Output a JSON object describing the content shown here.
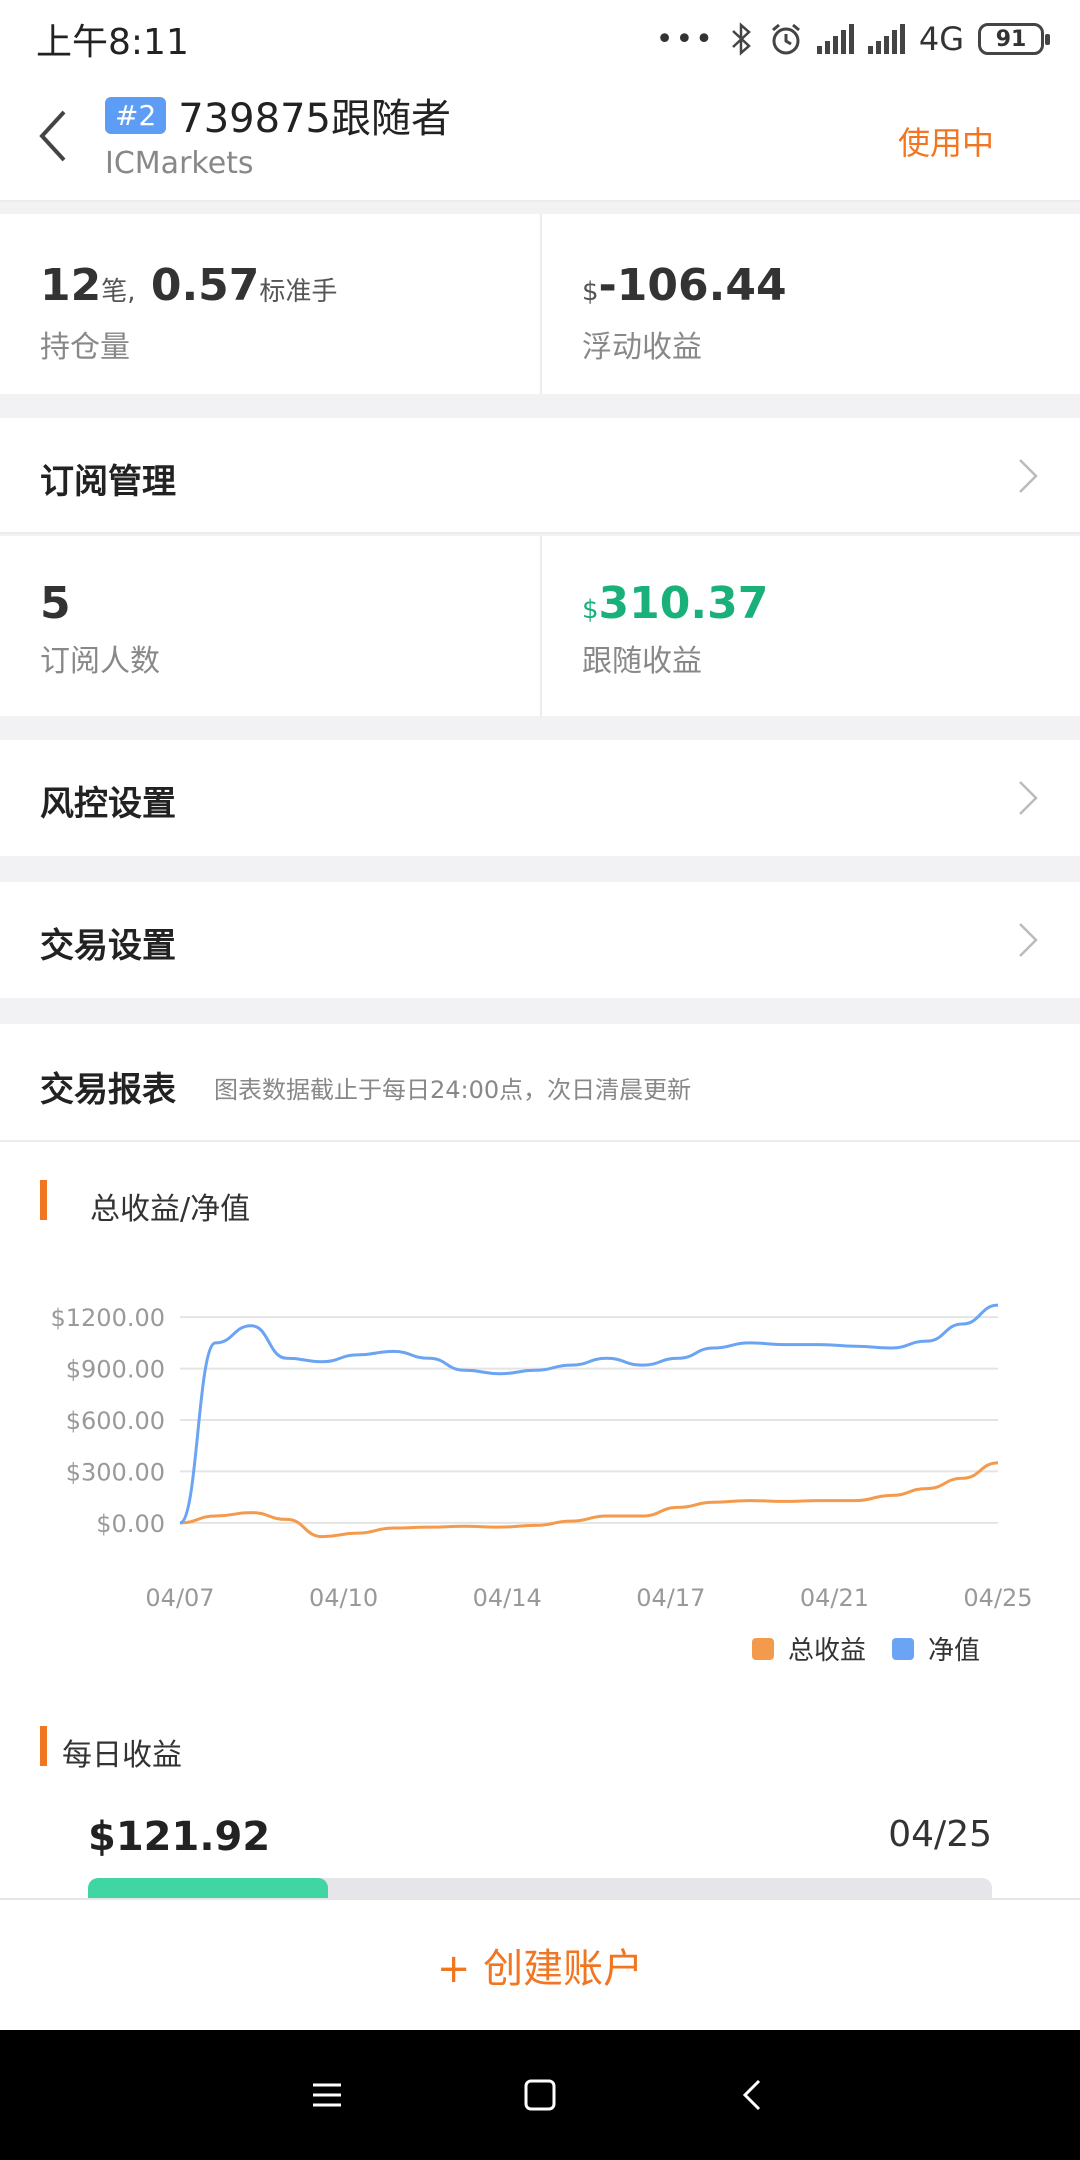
{
  "status_bar": {
    "time": "上午8:11",
    "network": "4G",
    "battery": "91"
  },
  "header": {
    "badge": "#2",
    "title": "739875跟随者",
    "subtitle": "ICMarkets",
    "status": "使用中"
  },
  "positions": {
    "count": "12",
    "count_unit": "笔,",
    "lots": "0.57",
    "lots_unit": "标准手",
    "label": "持仓量",
    "currency": "$",
    "floating": "-106.44",
    "floating_label": "浮动收益"
  },
  "subscription": {
    "title": "订阅管理",
    "subscribers": "5",
    "subscribers_label": "订阅人数",
    "currency": "$",
    "follow_profit": "310.37",
    "follow_profit_label": "跟随收益"
  },
  "risk": {
    "title": "风控设置"
  },
  "trade": {
    "title": "交易设置"
  },
  "report": {
    "title": "交易报表",
    "note": "图表数据截止于每日24:00点，次日清晨更新"
  },
  "chart_section": {
    "title": "总收益/净值"
  },
  "chart_data": {
    "type": "line",
    "title": "总收益/净值",
    "x_ticks": [
      "04/07",
      "04/10",
      "04/14",
      "04/17",
      "04/21",
      "04/25"
    ],
    "y_ticks": [
      "$1200.00",
      "$900.00",
      "$600.00",
      "$300.00",
      "$0.00"
    ],
    "ylim": [
      -100,
      1300
    ],
    "grid": true,
    "legend": "bottom-right",
    "series": [
      {
        "name": "总收益",
        "color": "#f39a4c",
        "values": [
          0,
          40,
          60,
          20,
          -80,
          -60,
          -30,
          -25,
          -20,
          -25,
          -15,
          10,
          40,
          40,
          90,
          120,
          130,
          125,
          130,
          130,
          160,
          200,
          260,
          350
        ]
      },
      {
        "name": "净值",
        "color": "#6aa4f3",
        "values": [
          0,
          1050,
          1150,
          960,
          940,
          980,
          1000,
          960,
          890,
          870,
          890,
          920,
          960,
          920,
          960,
          1020,
          1050,
          1040,
          1040,
          1030,
          1020,
          1060,
          1160,
          1270
        ]
      }
    ]
  },
  "daily": {
    "title": "每日收益",
    "value": "$121.92",
    "date": "04/25",
    "fill_fraction": 0.265
  },
  "create": {
    "label": "+ 创建账户"
  }
}
